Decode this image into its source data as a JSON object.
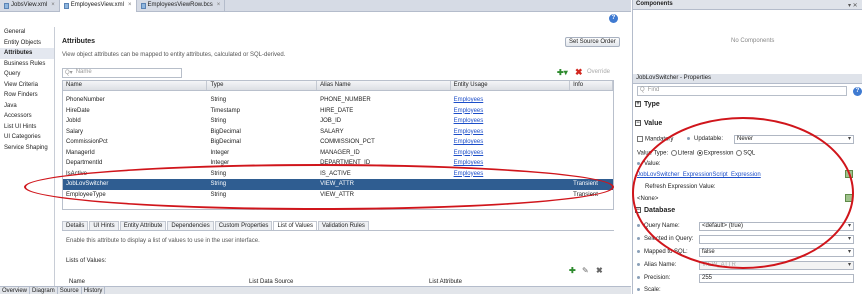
{
  "file_tabs": [
    "JobsView.xml",
    "EmployeesView.xml",
    "EmployeesViewRow.bcs"
  ],
  "nav_items": [
    "General",
    "Entity Objects",
    "Attributes",
    "Business Rules",
    "Query",
    "View Criteria",
    "Row Finders",
    "Java",
    "Accessors",
    "List UI Hints",
    "UI Categories",
    "Service Shaping"
  ],
  "selected_nav": "Attributes",
  "main": {
    "title": "Attributes",
    "description": "View object attributes can be mapped to entity attributes, calculated or SQL-derived.",
    "set_source_order": "Set Source Order",
    "filter_placeholder": "Name",
    "override_label": "Override",
    "columns": [
      "Name",
      "Type",
      "Alias Name",
      "Entity Usage",
      "Info"
    ],
    "rows": [
      [
        "PhoneNumber",
        "String",
        "PHONE_NUMBER",
        "Employees",
        ""
      ],
      [
        "HireDate",
        "Timestamp",
        "HIRE_DATE",
        "Employees",
        ""
      ],
      [
        "JobId",
        "String",
        "JOB_ID",
        "Employees",
        ""
      ],
      [
        "Salary",
        "BigDecimal",
        "SALARY",
        "Employees",
        ""
      ],
      [
        "CommissionPct",
        "BigDecimal",
        "COMMISSION_PCT",
        "Employees",
        ""
      ],
      [
        "ManagerId",
        "Integer",
        "MANAGER_ID",
        "Employees",
        ""
      ],
      [
        "DepartmentId",
        "Integer",
        "DEPARTMENT_ID",
        "Employees",
        ""
      ],
      [
        "IsActive",
        "String",
        "IS_ACTIVE",
        "Employees",
        ""
      ],
      [
        "JobLovSwitcher",
        "String",
        "VIEW_ATTR",
        "",
        "Transient"
      ],
      [
        "EmployeeType",
        "String",
        "VIEW_ATTR",
        "",
        "Transient"
      ]
    ],
    "selected_row": 8,
    "detail_tabs": [
      "Details",
      "UI Hints",
      "Entity Attribute",
      "Dependencies",
      "Custom Properties",
      "List of Values",
      "Validation Rules"
    ],
    "active_detail_tab": "List of Values",
    "lov_description": "Enable this attribute to display a list of values to use in the user interface.",
    "lov_label": "Lists of Values:",
    "lov_columns": [
      "Name",
      "List Data Source",
      "List Attribute"
    ]
  },
  "footer_tabs": [
    "Overview",
    "Diagram",
    "Source",
    "History"
  ],
  "components_panel": {
    "title": "Components",
    "empty_text": "No Components"
  },
  "properties_panel": {
    "title": "JobLovSwitcher - Properties",
    "find_placeholder": "Find",
    "cat_type": "Type",
    "cat_value": "Value",
    "mandatory": "Mandatory",
    "updatable": "Updatable:",
    "updatable_value": "Never",
    "value_type": "Value Type:",
    "vt_literal": "Literal",
    "vt_expression": "Expression",
    "vt_sql": "SQL",
    "value_label": "Value:",
    "value": "JobLovSwitcher_ExpressionScript_Expression",
    "refresh_label": "Refresh Expression Value:",
    "refresh_value": "<None>",
    "cat_database": "Database",
    "query_label": "Query Name:",
    "query_value": "<default> (true)",
    "selected_label": "Selected in Query:",
    "mapped_label": "Mapped to SQL:",
    "mapped_value": "false",
    "alias_label": "Alias Name:",
    "alias_value": "VIEW_ATTR",
    "precision_label": "Precision:",
    "precision_value": "255",
    "scale_label": "Scale:"
  },
  "colors": {
    "accent": "#2f5d91",
    "annotation": "#d0151b",
    "link": "#1c4ec9"
  }
}
